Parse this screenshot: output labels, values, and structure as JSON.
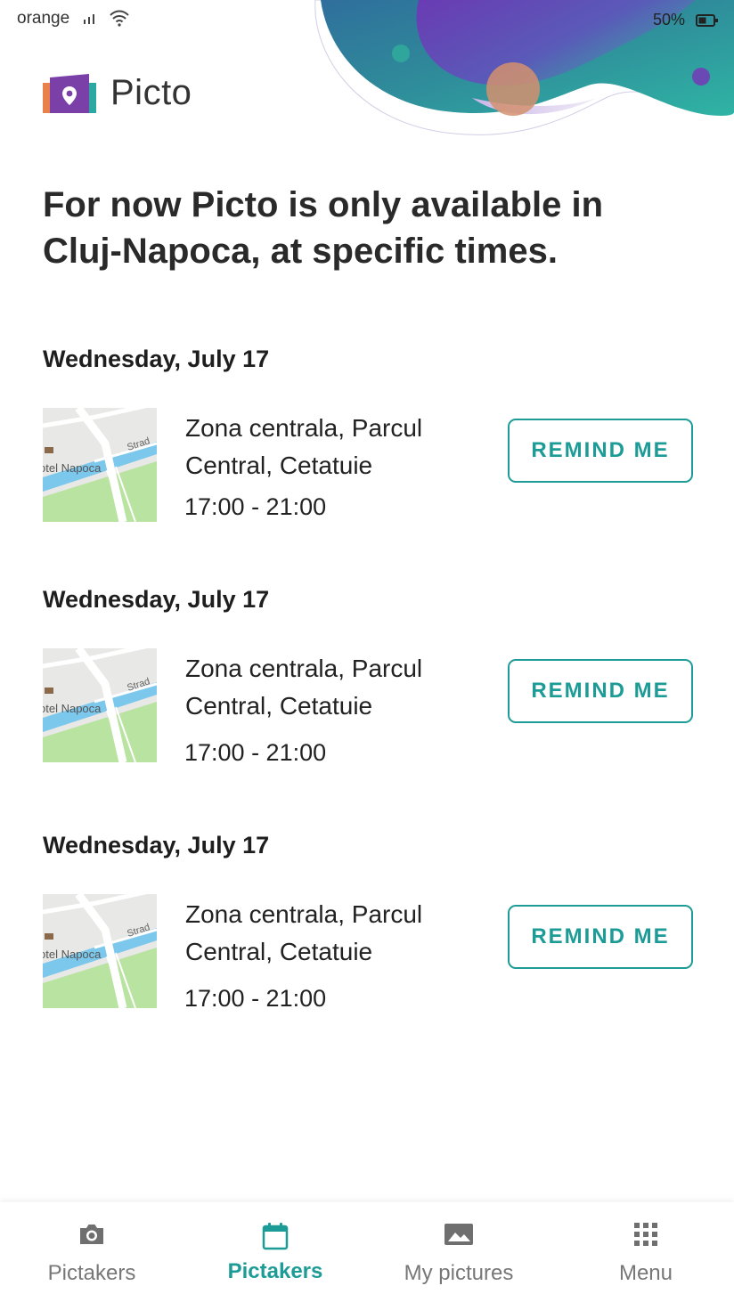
{
  "status_bar": {
    "carrier": "orange",
    "battery": "50%"
  },
  "app": {
    "name": "Picto"
  },
  "headline": "For now Picto is only available in Cluj-Napoca, at specific times.",
  "events": [
    {
      "date": "Wednesday, July 17",
      "place": "Zona centrala, Parcul Central, Cetatuie",
      "time": "17:00 - 21:00",
      "button": "REMIND ME",
      "map_label": "otel Napoca",
      "map_street": "Strad"
    },
    {
      "date": "Wednesday, July 17",
      "place": "Zona centrala, Parcul Central, Cetatuie",
      "time": "17:00 - 21:00",
      "button": "REMIND ME",
      "map_label": "otel Napoca",
      "map_street": "Strad"
    },
    {
      "date": "Wednesday, July 17",
      "place": "Zona centrala, Parcul Central, Cetatuie",
      "time": "17:00 - 21:00",
      "button": "REMIND ME",
      "map_label": "otel Napoca",
      "map_street": "Strad"
    }
  ],
  "bottom_nav": {
    "active_index": 1,
    "items": [
      {
        "label": "Pictakers",
        "icon": "camera-icon"
      },
      {
        "label": "Pictakers",
        "icon": "calendar-icon"
      },
      {
        "label": "My pictures",
        "icon": "image-icon"
      },
      {
        "label": "Menu",
        "icon": "grid-icon"
      }
    ]
  },
  "colors": {
    "accent": "#1d9c97",
    "logo_purple": "#7b3fa8",
    "logo_orange": "#e8824a",
    "logo_teal": "#2aa8a1"
  }
}
